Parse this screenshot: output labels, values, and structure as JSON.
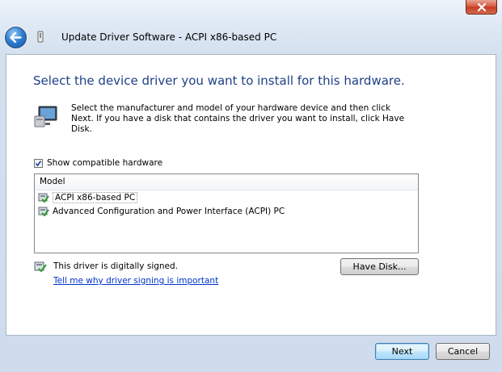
{
  "window": {
    "title": "Update Driver Software - ACPI x86-based PC",
    "close_glyph": "x"
  },
  "wizard": {
    "heading": "Select the device driver you want to install for this hardware.",
    "instructions": "Select the manufacturer and model of your hardware device and then click Next. If you have a disk that contains the driver you want to install, click Have Disk."
  },
  "compatible": {
    "label": "Show compatible hardware",
    "checked": true
  },
  "model_list": {
    "header": "Model",
    "items": [
      {
        "label": "ACPI x86-based PC",
        "selected": true
      },
      {
        "label": "Advanced Configuration and Power Interface (ACPI) PC",
        "selected": false
      }
    ]
  },
  "signing": {
    "status": "This driver is digitally signed.",
    "link": "Tell me why driver signing is important"
  },
  "buttons": {
    "have_disk": "Have Disk...",
    "next": "Next",
    "cancel": "Cancel"
  },
  "colors": {
    "heading": "#1e3f87",
    "link": "#0033cc",
    "close": "#c33b22"
  },
  "icons": {
    "back": "back-arrow-icon",
    "wizard": "device-wizard-icon",
    "hardware": "computer-monitor-icon",
    "driver": "driver-package-icon",
    "signed": "signed-driver-icon"
  }
}
